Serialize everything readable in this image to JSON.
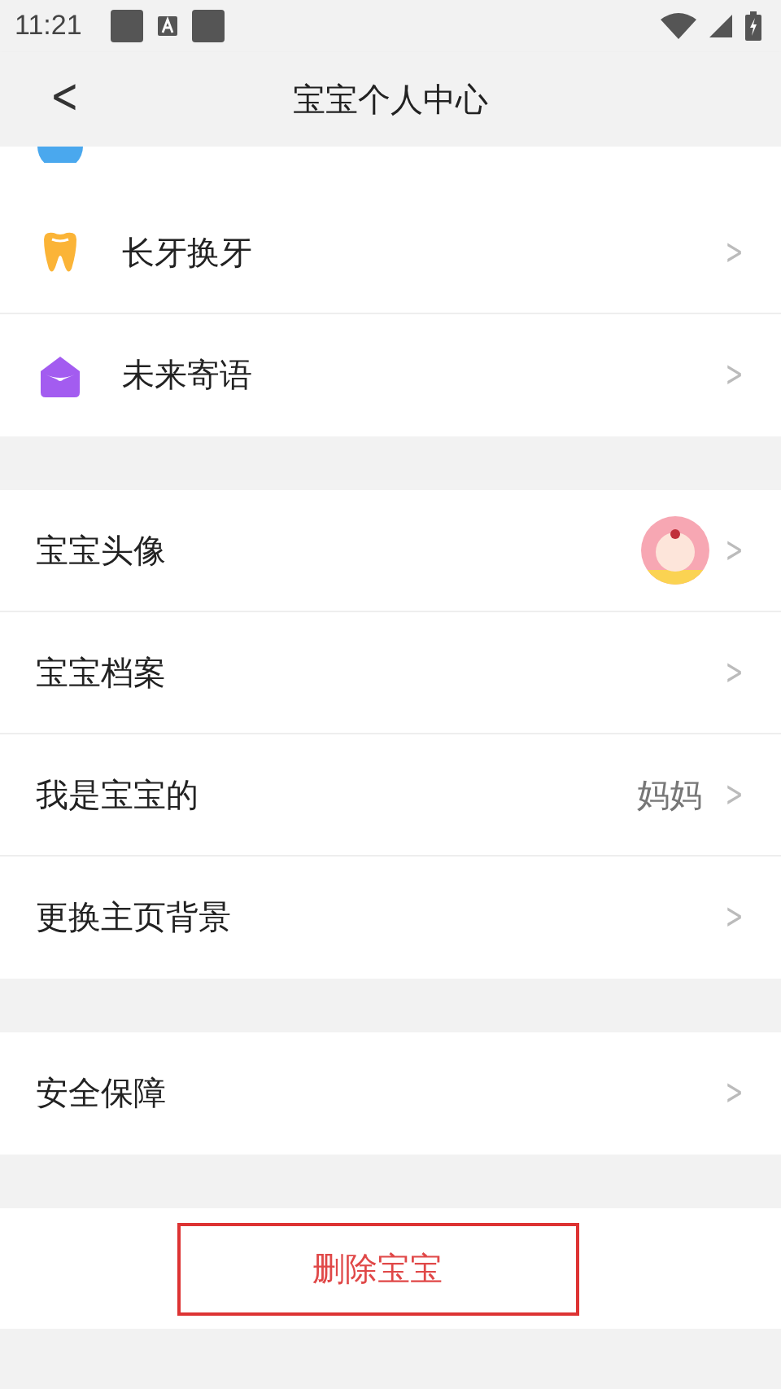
{
  "status_bar": {
    "time": "11:21"
  },
  "header": {
    "back": "<",
    "title": "宝宝个人中心"
  },
  "sections": [
    {
      "items": [
        {
          "kind": "tooth",
          "label": "长牙换牙",
          "chevron": ">"
        },
        {
          "kind": "envelope",
          "label": "未来寄语",
          "chevron": ">"
        }
      ]
    },
    {
      "items": [
        {
          "kind": "avatar",
          "label": "宝宝头像",
          "chevron": ">"
        },
        {
          "kind": "plain",
          "label": "宝宝档案",
          "chevron": ">"
        },
        {
          "kind": "value",
          "label": "我是宝宝的",
          "value": "妈妈",
          "chevron": ">"
        },
        {
          "kind": "plain",
          "label": "更换主页背景",
          "chevron": ">"
        }
      ]
    },
    {
      "items": [
        {
          "kind": "plain",
          "label": "安全保障",
          "chevron": ">"
        }
      ]
    }
  ],
  "delete_button": "删除宝宝"
}
